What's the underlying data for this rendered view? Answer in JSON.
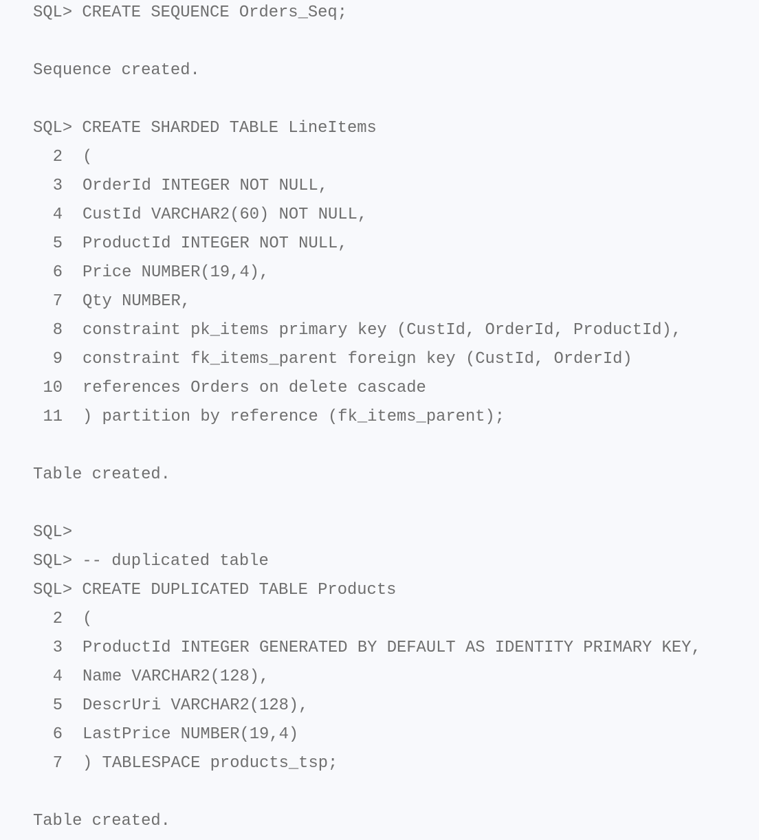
{
  "console": {
    "prompt": "SQL>",
    "blocks": [
      {
        "type": "command",
        "first_line": "CREATE SEQUENCE Orders_Seq;",
        "continuation": []
      },
      {
        "type": "output",
        "text": "Sequence created."
      },
      {
        "type": "command",
        "first_line": "CREATE SHARDED TABLE LineItems",
        "continuation": [
          {
            "num": "2",
            "text": "("
          },
          {
            "num": "3",
            "text": "OrderId INTEGER NOT NULL,"
          },
          {
            "num": "4",
            "text": "CustId VARCHAR2(60) NOT NULL,"
          },
          {
            "num": "5",
            "text": "ProductId INTEGER NOT NULL,"
          },
          {
            "num": "6",
            "text": "Price NUMBER(19,4),"
          },
          {
            "num": "7",
            "text": "Qty NUMBER,"
          },
          {
            "num": "8",
            "text": "constraint pk_items primary key (CustId, OrderId, ProductId),"
          },
          {
            "num": "9",
            "text": "constraint fk_items_parent foreign key (CustId, OrderId)"
          },
          {
            "num": "10",
            "text": "references Orders on delete cascade"
          },
          {
            "num": "11",
            "text": ") partition by reference (fk_items_parent);"
          }
        ]
      },
      {
        "type": "output",
        "text": "Table created."
      },
      {
        "type": "prompt-only",
        "first_line": ""
      },
      {
        "type": "command",
        "first_line": "-- duplicated table",
        "continuation": []
      },
      {
        "type": "command",
        "first_line": "CREATE DUPLICATED TABLE Products",
        "continuation": [
          {
            "num": "2",
            "text": "("
          },
          {
            "num": "3",
            "text": "ProductId INTEGER GENERATED BY DEFAULT AS IDENTITY PRIMARY KEY,"
          },
          {
            "num": "4",
            "text": "Name VARCHAR2(128),"
          },
          {
            "num": "5",
            "text": "DescrUri VARCHAR2(128),"
          },
          {
            "num": "6",
            "text": "LastPrice NUMBER(19,4)"
          },
          {
            "num": "7",
            "text": ") TABLESPACE products_tsp;"
          }
        ]
      },
      {
        "type": "output",
        "text": "Table created."
      }
    ]
  },
  "colors": {
    "background": "#f8f9fc",
    "text": "#6f6f6f"
  }
}
